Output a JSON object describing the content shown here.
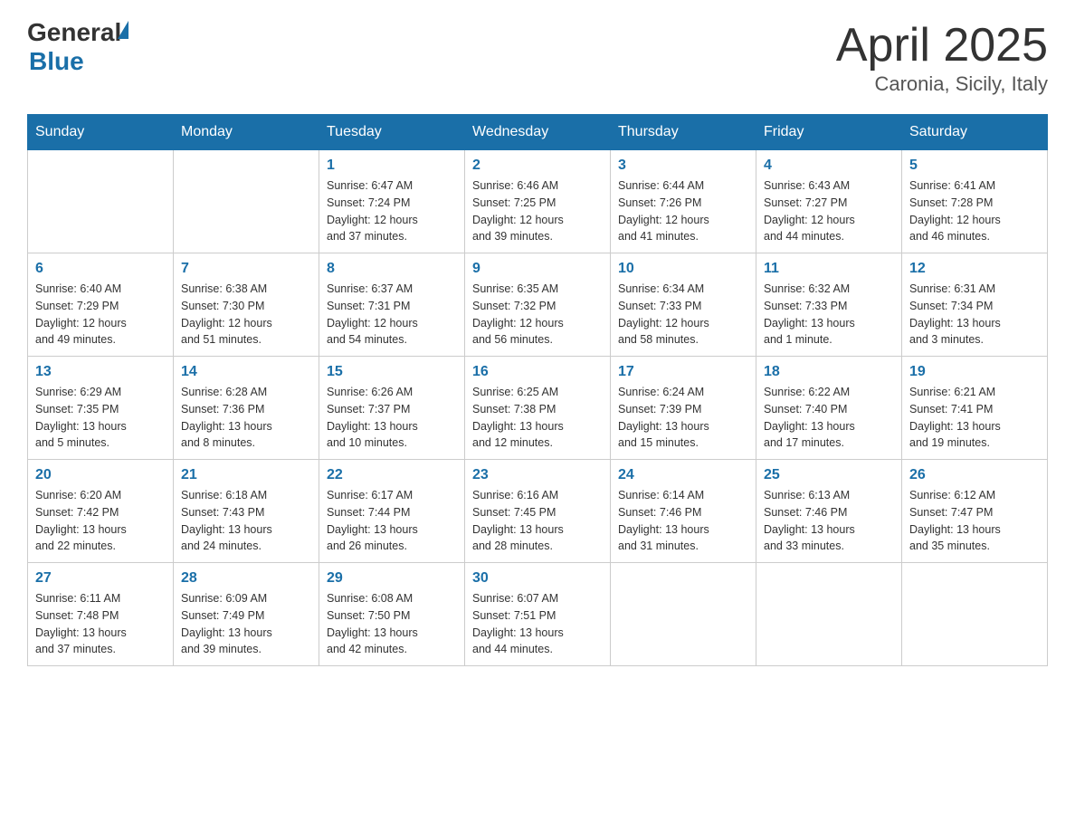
{
  "header": {
    "logo_general": "General",
    "logo_blue": "Blue",
    "title": "April 2025",
    "subtitle": "Caronia, Sicily, Italy"
  },
  "calendar": {
    "days_of_week": [
      "Sunday",
      "Monday",
      "Tuesday",
      "Wednesday",
      "Thursday",
      "Friday",
      "Saturday"
    ],
    "weeks": [
      [
        {
          "day": "",
          "info": ""
        },
        {
          "day": "",
          "info": ""
        },
        {
          "day": "1",
          "info": "Sunrise: 6:47 AM\nSunset: 7:24 PM\nDaylight: 12 hours\nand 37 minutes."
        },
        {
          "day": "2",
          "info": "Sunrise: 6:46 AM\nSunset: 7:25 PM\nDaylight: 12 hours\nand 39 minutes."
        },
        {
          "day": "3",
          "info": "Sunrise: 6:44 AM\nSunset: 7:26 PM\nDaylight: 12 hours\nand 41 minutes."
        },
        {
          "day": "4",
          "info": "Sunrise: 6:43 AM\nSunset: 7:27 PM\nDaylight: 12 hours\nand 44 minutes."
        },
        {
          "day": "5",
          "info": "Sunrise: 6:41 AM\nSunset: 7:28 PM\nDaylight: 12 hours\nand 46 minutes."
        }
      ],
      [
        {
          "day": "6",
          "info": "Sunrise: 6:40 AM\nSunset: 7:29 PM\nDaylight: 12 hours\nand 49 minutes."
        },
        {
          "day": "7",
          "info": "Sunrise: 6:38 AM\nSunset: 7:30 PM\nDaylight: 12 hours\nand 51 minutes."
        },
        {
          "day": "8",
          "info": "Sunrise: 6:37 AM\nSunset: 7:31 PM\nDaylight: 12 hours\nand 54 minutes."
        },
        {
          "day": "9",
          "info": "Sunrise: 6:35 AM\nSunset: 7:32 PM\nDaylight: 12 hours\nand 56 minutes."
        },
        {
          "day": "10",
          "info": "Sunrise: 6:34 AM\nSunset: 7:33 PM\nDaylight: 12 hours\nand 58 minutes."
        },
        {
          "day": "11",
          "info": "Sunrise: 6:32 AM\nSunset: 7:33 PM\nDaylight: 13 hours\nand 1 minute."
        },
        {
          "day": "12",
          "info": "Sunrise: 6:31 AM\nSunset: 7:34 PM\nDaylight: 13 hours\nand 3 minutes."
        }
      ],
      [
        {
          "day": "13",
          "info": "Sunrise: 6:29 AM\nSunset: 7:35 PM\nDaylight: 13 hours\nand 5 minutes."
        },
        {
          "day": "14",
          "info": "Sunrise: 6:28 AM\nSunset: 7:36 PM\nDaylight: 13 hours\nand 8 minutes."
        },
        {
          "day": "15",
          "info": "Sunrise: 6:26 AM\nSunset: 7:37 PM\nDaylight: 13 hours\nand 10 minutes."
        },
        {
          "day": "16",
          "info": "Sunrise: 6:25 AM\nSunset: 7:38 PM\nDaylight: 13 hours\nand 12 minutes."
        },
        {
          "day": "17",
          "info": "Sunrise: 6:24 AM\nSunset: 7:39 PM\nDaylight: 13 hours\nand 15 minutes."
        },
        {
          "day": "18",
          "info": "Sunrise: 6:22 AM\nSunset: 7:40 PM\nDaylight: 13 hours\nand 17 minutes."
        },
        {
          "day": "19",
          "info": "Sunrise: 6:21 AM\nSunset: 7:41 PM\nDaylight: 13 hours\nand 19 minutes."
        }
      ],
      [
        {
          "day": "20",
          "info": "Sunrise: 6:20 AM\nSunset: 7:42 PM\nDaylight: 13 hours\nand 22 minutes."
        },
        {
          "day": "21",
          "info": "Sunrise: 6:18 AM\nSunset: 7:43 PM\nDaylight: 13 hours\nand 24 minutes."
        },
        {
          "day": "22",
          "info": "Sunrise: 6:17 AM\nSunset: 7:44 PM\nDaylight: 13 hours\nand 26 minutes."
        },
        {
          "day": "23",
          "info": "Sunrise: 6:16 AM\nSunset: 7:45 PM\nDaylight: 13 hours\nand 28 minutes."
        },
        {
          "day": "24",
          "info": "Sunrise: 6:14 AM\nSunset: 7:46 PM\nDaylight: 13 hours\nand 31 minutes."
        },
        {
          "day": "25",
          "info": "Sunrise: 6:13 AM\nSunset: 7:46 PM\nDaylight: 13 hours\nand 33 minutes."
        },
        {
          "day": "26",
          "info": "Sunrise: 6:12 AM\nSunset: 7:47 PM\nDaylight: 13 hours\nand 35 minutes."
        }
      ],
      [
        {
          "day": "27",
          "info": "Sunrise: 6:11 AM\nSunset: 7:48 PM\nDaylight: 13 hours\nand 37 minutes."
        },
        {
          "day": "28",
          "info": "Sunrise: 6:09 AM\nSunset: 7:49 PM\nDaylight: 13 hours\nand 39 minutes."
        },
        {
          "day": "29",
          "info": "Sunrise: 6:08 AM\nSunset: 7:50 PM\nDaylight: 13 hours\nand 42 minutes."
        },
        {
          "day": "30",
          "info": "Sunrise: 6:07 AM\nSunset: 7:51 PM\nDaylight: 13 hours\nand 44 minutes."
        },
        {
          "day": "",
          "info": ""
        },
        {
          "day": "",
          "info": ""
        },
        {
          "day": "",
          "info": ""
        }
      ]
    ]
  }
}
